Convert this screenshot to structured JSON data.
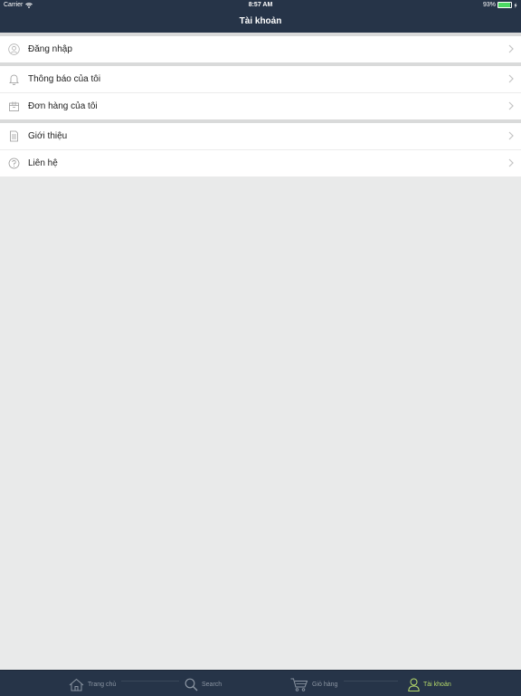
{
  "status_bar": {
    "carrier": "Carrier",
    "time": "8:57 AM",
    "battery": "93%",
    "battery_level": 0.93,
    "icons": [
      "wifi-icon",
      "battery-icon",
      "charging-icon"
    ]
  },
  "nav": {
    "title": "Tài khoản"
  },
  "menu": {
    "section1": [
      {
        "label": "Đăng nhập",
        "icon": "user-circle-icon"
      }
    ],
    "section2": [
      {
        "label": "Thông báo của tôi",
        "icon": "bell-icon"
      },
      {
        "label": "Đơn hàng của tôi",
        "icon": "box-icon"
      }
    ],
    "section3": [
      {
        "label": "Giới thiệu",
        "icon": "document-icon"
      },
      {
        "label": "Liên hệ",
        "icon": "help-circle-icon"
      }
    ]
  },
  "tabbar": {
    "tabs": [
      {
        "label": "Trang chủ",
        "icon": "home-icon",
        "active": false
      },
      {
        "label": "Search",
        "icon": "search-icon",
        "active": false
      },
      {
        "label": "Giỏ hàng",
        "icon": "cart-icon",
        "active": false
      },
      {
        "label": "Tài khoản",
        "icon": "user-icon",
        "active": true
      }
    ],
    "active_color": "#b5d96a",
    "inactive_color": "#8b95a2"
  },
  "colors": {
    "header_bg": "#263448",
    "page_bg": "#e9eaea"
  }
}
